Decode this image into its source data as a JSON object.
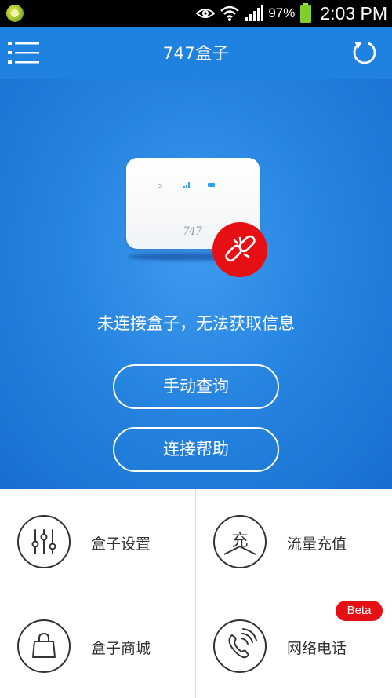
{
  "status_bar": {
    "battery_percent": "97%",
    "time": "2:03 PM",
    "icons": [
      "app-notification-icon",
      "eye-icon",
      "wifi-icon",
      "signal-icon",
      "battery-icon"
    ]
  },
  "header": {
    "title": "747盒子",
    "menu_icon": "menu-icon",
    "refresh_icon": "refresh-icon",
    "background": "#1f82e0"
  },
  "hero": {
    "device_logo": "747",
    "status_message": "未连接盒子，无法获取信息",
    "buttons": [
      {
        "label": "手动查询"
      },
      {
        "label": "连接帮助"
      }
    ],
    "badge_color": "#e60f14"
  },
  "grid": [
    {
      "label": "盒子设置",
      "icon": "settings-sliders-icon"
    },
    {
      "label": "流量充值",
      "icon": "recharge-icon",
      "icon_char": "充"
    },
    {
      "label": "盒子商城",
      "icon": "shopping-bag-icon"
    },
    {
      "label": "网络电话",
      "icon": "phone-call-icon",
      "badge": "Beta"
    }
  ]
}
